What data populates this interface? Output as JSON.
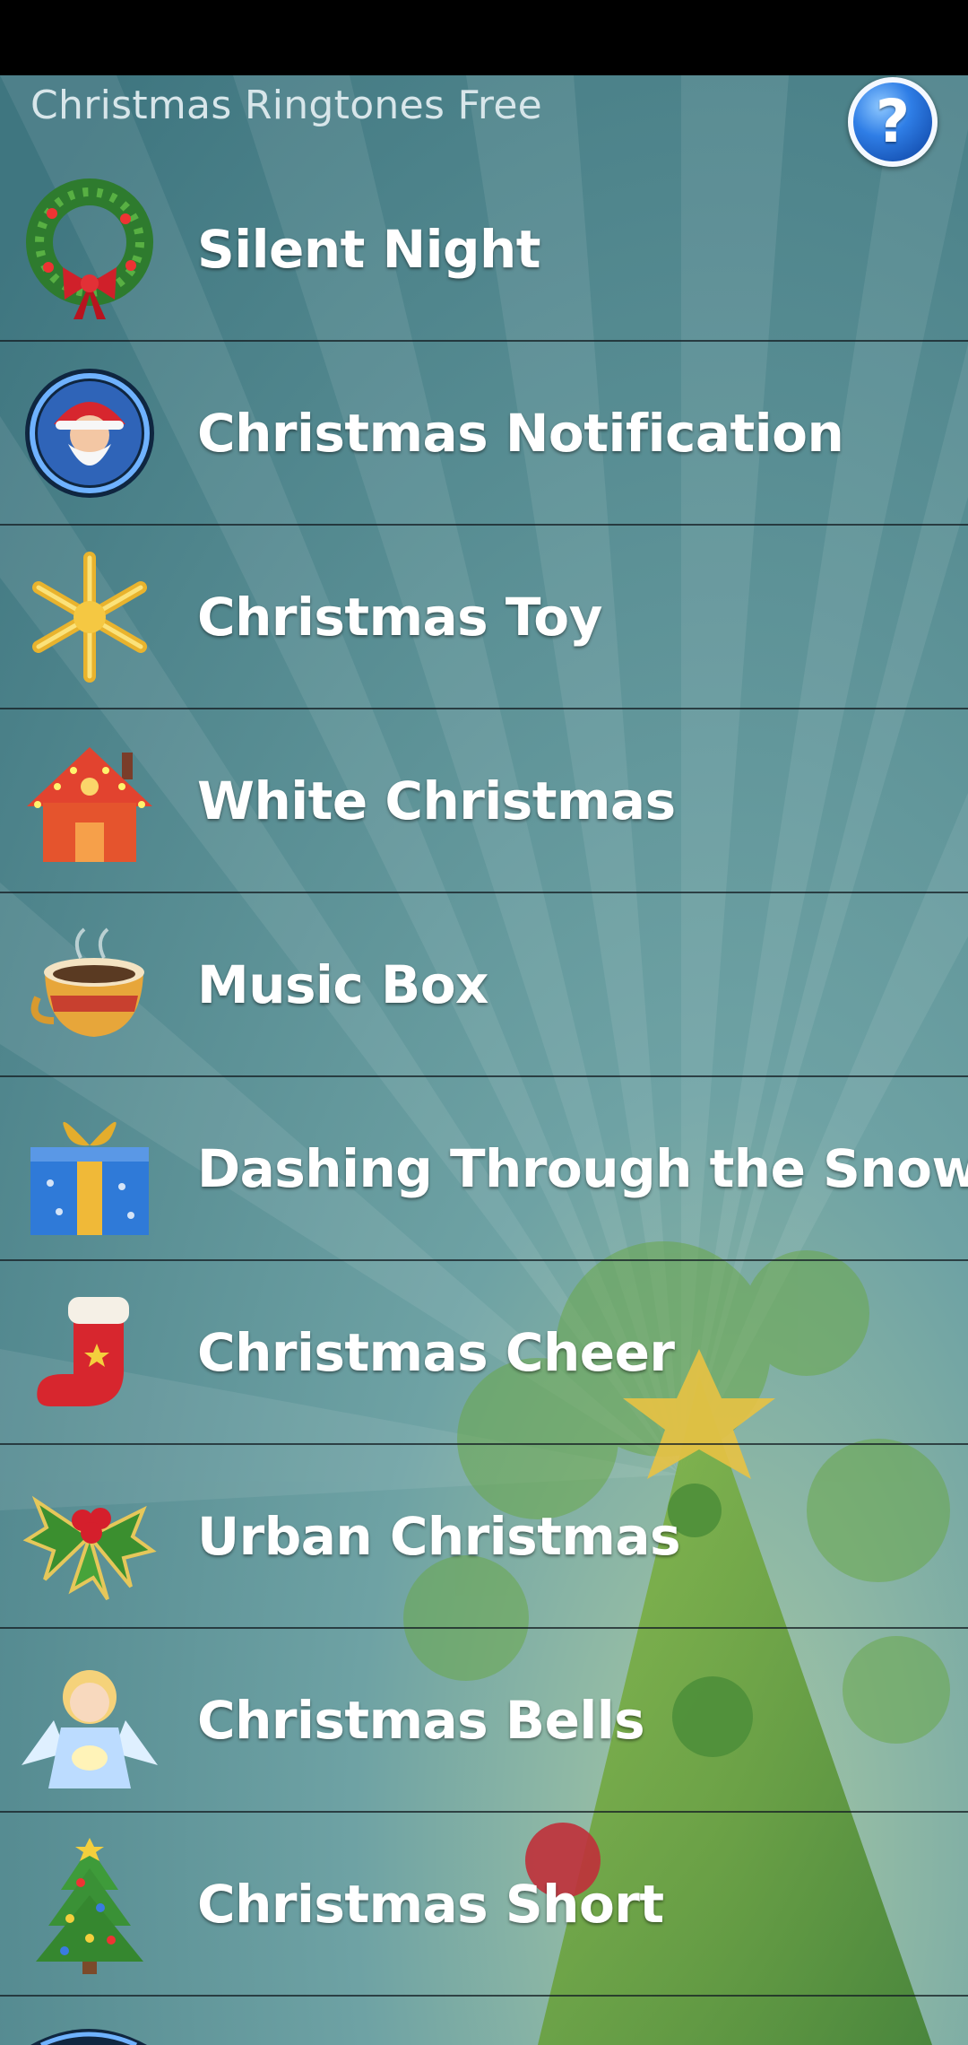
{
  "app": {
    "title": "Christmas Ringtones Free",
    "help_icon": "help-icon"
  },
  "colors": {
    "background": "#4d8a93",
    "divider": "#1b2a2f",
    "label": "#ffffff"
  },
  "ringtones": [
    {
      "label": "Silent Night",
      "icon": "wreath-icon"
    },
    {
      "label": "Christmas Notification",
      "icon": "santa-icon"
    },
    {
      "label": "Christmas Toy",
      "icon": "snowflake-icon"
    },
    {
      "label": "White Christmas",
      "icon": "house-icon"
    },
    {
      "label": "Music Box",
      "icon": "cup-icon"
    },
    {
      "label": "Dashing Through the Snow",
      "icon": "gift-icon"
    },
    {
      "label": "Christmas Cheer",
      "icon": "stocking-icon"
    },
    {
      "label": "Urban Christmas",
      "icon": "holly-icon"
    },
    {
      "label": "Christmas Bells",
      "icon": "angel-icon"
    },
    {
      "label": "Christmas Short",
      "icon": "christmas-tree-icon"
    }
  ]
}
